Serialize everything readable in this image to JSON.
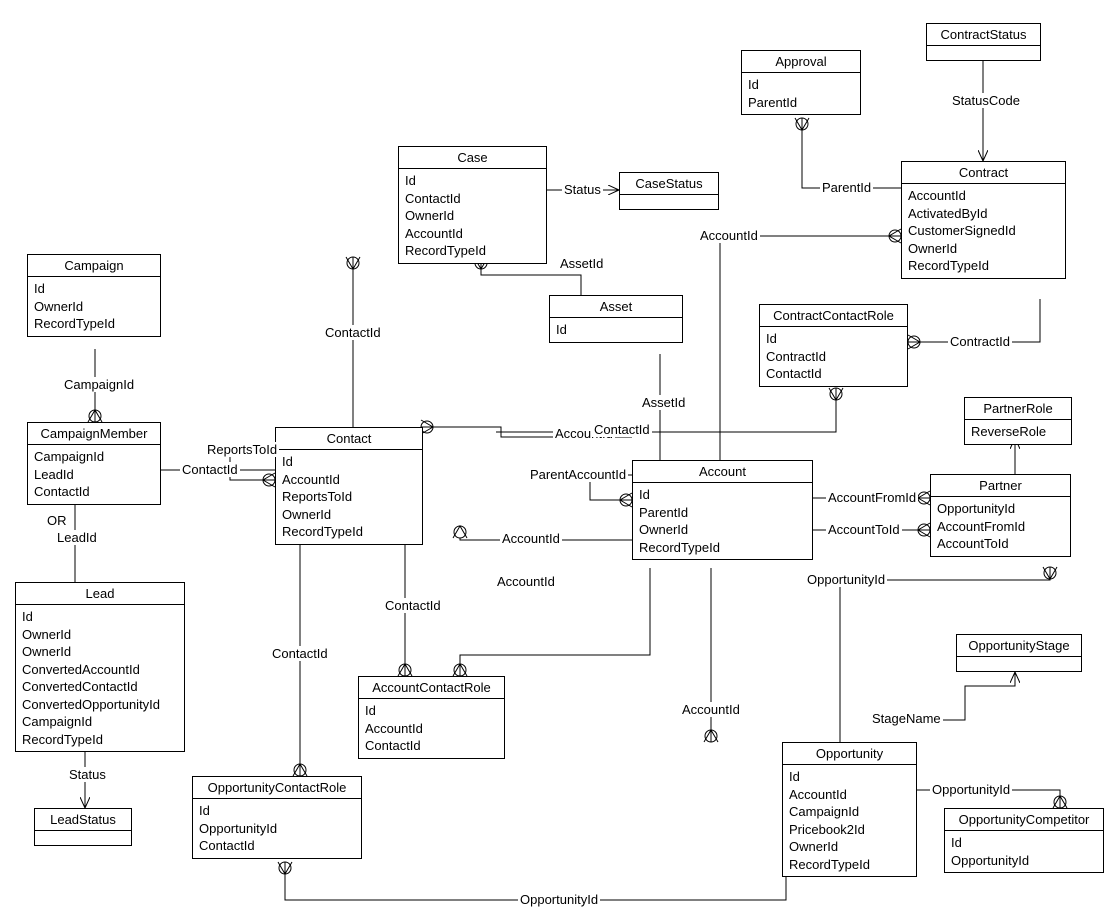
{
  "entities": {
    "Campaign": {
      "title": "Campaign",
      "attrs": [
        "Id",
        "OwnerId",
        "RecordTypeId"
      ]
    },
    "CampaignMember": {
      "title": "CampaignMember",
      "attrs": [
        "CampaignId",
        "LeadId",
        "ContactId"
      ]
    },
    "Lead": {
      "title": "Lead",
      "attrs": [
        "Id",
        "OwnerId",
        "OwnerId",
        "ConvertedAccountId",
        "ConvertedContactId",
        "ConvertedOpportunityId",
        "CampaignId",
        "RecordTypeId"
      ]
    },
    "LeadStatus": {
      "title": "LeadStatus",
      "attrs": []
    },
    "Case": {
      "title": "Case",
      "attrs": [
        "Id",
        "ContactId",
        "OwnerId",
        "AccountId",
        "RecordTypeId"
      ]
    },
    "CaseStatus": {
      "title": "CaseStatus",
      "attrs": []
    },
    "Asset": {
      "title": "Asset",
      "attrs": [
        "Id"
      ]
    },
    "Contact": {
      "title": "Contact",
      "attrs": [
        "Id",
        "AccountId",
        "ReportsToId",
        "OwnerId",
        "RecordTypeId"
      ]
    },
    "Account": {
      "title": "Account",
      "attrs": [
        "Id",
        "ParentId",
        "OwnerId",
        "RecordTypeId"
      ]
    },
    "AccountContactRole": {
      "title": "AccountContactRole",
      "attrs": [
        "Id",
        "AccountId",
        "ContactId"
      ]
    },
    "OpportunityContactRole": {
      "title": "OpportunityContactRole",
      "attrs": [
        "Id",
        "OpportunityId",
        "ContactId"
      ]
    },
    "Approval": {
      "title": "Approval",
      "attrs": [
        "Id",
        "ParentId"
      ]
    },
    "ContractStatus": {
      "title": "ContractStatus",
      "attrs": []
    },
    "Contract": {
      "title": "Contract",
      "attrs": [
        "AccountId",
        "ActivatedById",
        "CustomerSignedId",
        "OwnerId",
        "RecordTypeId"
      ]
    },
    "ContractContactRole": {
      "title": "ContractContactRole",
      "attrs": [
        "Id",
        "ContractId",
        "ContactId"
      ]
    },
    "PartnerRole": {
      "title": "PartnerRole",
      "attrs": [
        "ReverseRole"
      ]
    },
    "Partner": {
      "title": "Partner",
      "attrs": [
        "OpportunityId",
        "AccountFromId",
        "AccountToId"
      ]
    },
    "OpportunityStage": {
      "title": "OpportunityStage",
      "attrs": []
    },
    "Opportunity": {
      "title": "Opportunity",
      "attrs": [
        "Id",
        "AccountId",
        "CampaignId",
        "Pricebook2Id",
        "OwnerId",
        "RecordTypeId"
      ]
    },
    "OpportunityCompetitor": {
      "title": "OpportunityCompetitor",
      "attrs": [
        "Id",
        "OpportunityId"
      ]
    }
  },
  "labels": {
    "CampaignId": "CampaignId",
    "ContactId": "ContactId",
    "OR": "OR",
    "LeadId": "LeadId",
    "Status": "Status",
    "ReportsToId": "ReportsToId",
    "AssetId": "AssetId",
    "AccountId": "AccountId",
    "ParentAccountId": "ParentAccountId",
    "ParentId": "ParentId",
    "StatusCode": "StatusCode",
    "ContractId": "ContractId",
    "AccountFromId": "AccountFromId",
    "AccountToId": "AccountToId",
    "OpportunityId": "OpportunityId",
    "StageName": "StageName"
  }
}
